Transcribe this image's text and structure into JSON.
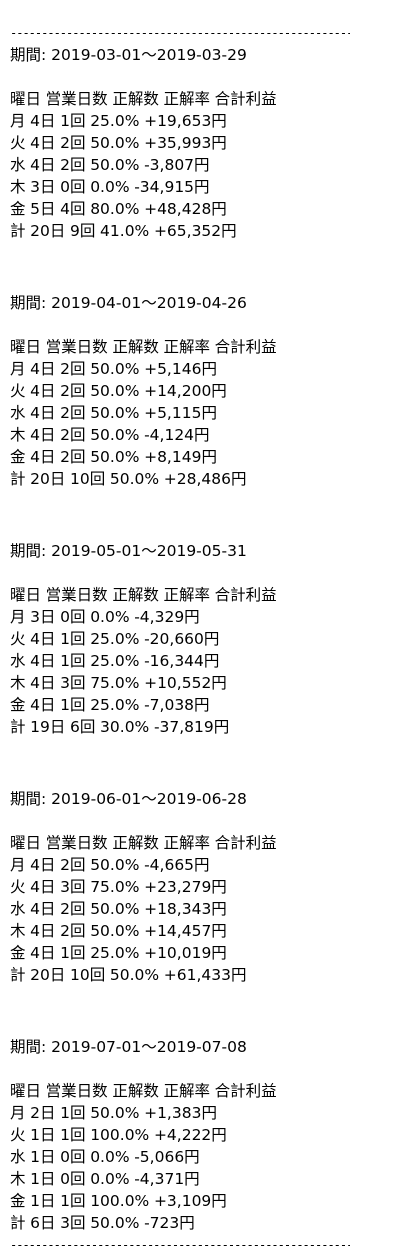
{
  "rule": "------------------------------------------------------------",
  "periods": [
    {
      "label": "期間: 2019-03-01〜2019-03-29",
      "header": [
        "曜日",
        "営業日数",
        "正解数",
        "正解率",
        "合計利益"
      ],
      "rows": [
        [
          "月",
          "4日",
          "1回",
          "25.0%",
          "+19,653円"
        ],
        [
          "火",
          "4日",
          "2回",
          "50.0%",
          "+35,993円"
        ],
        [
          "水",
          "4日",
          "2回",
          "50.0%",
          "-3,807円"
        ],
        [
          "木",
          "3日",
          "0回",
          "0.0%",
          "-34,915円"
        ],
        [
          "金",
          "5日",
          "4回",
          "80.0%",
          "+48,428円"
        ],
        [
          "計",
          "20日",
          "9回",
          "41.0%",
          "+65,352円"
        ]
      ]
    },
    {
      "label": "期間: 2019-04-01〜2019-04-26",
      "header": [
        "曜日",
        "営業日数",
        "正解数",
        "正解率",
        "合計利益"
      ],
      "rows": [
        [
          "月",
          "4日",
          "2回",
          "50.0%",
          "+5,146円"
        ],
        [
          "火",
          "4日",
          "2回",
          "50.0%",
          "+14,200円"
        ],
        [
          "水",
          "4日",
          "2回",
          "50.0%",
          "+5,115円"
        ],
        [
          "木",
          "4日",
          "2回",
          "50.0%",
          "-4,124円"
        ],
        [
          "金",
          "4日",
          "2回",
          "50.0%",
          "+8,149円"
        ],
        [
          "計",
          "20日",
          "10回",
          "50.0%",
          "+28,486円"
        ]
      ]
    },
    {
      "label": "期間: 2019-05-01〜2019-05-31",
      "header": [
        "曜日",
        "営業日数",
        "正解数",
        "正解率",
        "合計利益"
      ],
      "rows": [
        [
          "月",
          "3日",
          "0回",
          "0.0%",
          "-4,329円"
        ],
        [
          "火",
          "4日",
          "1回",
          "25.0%",
          "-20,660円"
        ],
        [
          "水",
          "4日",
          "1回",
          "25.0%",
          "-16,344円"
        ],
        [
          "木",
          "4日",
          "3回",
          "75.0%",
          "+10,552円"
        ],
        [
          "金",
          "4日",
          "1回",
          "25.0%",
          "-7,038円"
        ],
        [
          "計",
          "19日",
          "6回",
          "30.0%",
          "-37,819円"
        ]
      ]
    },
    {
      "label": "期間: 2019-06-01〜2019-06-28",
      "header": [
        "曜日",
        "営業日数",
        "正解数",
        "正解率",
        "合計利益"
      ],
      "rows": [
        [
          "月",
          "4日",
          "2回",
          "50.0%",
          "-4,665円"
        ],
        [
          "火",
          "4日",
          "3回",
          "75.0%",
          "+23,279円"
        ],
        [
          "水",
          "4日",
          "2回",
          "50.0%",
          "+18,343円"
        ],
        [
          "木",
          "4日",
          "2回",
          "50.0%",
          "+14,457円"
        ],
        [
          "金",
          "4日",
          "1回",
          "25.0%",
          "+10,019円"
        ],
        [
          "計",
          "20日",
          "10回",
          "50.0%",
          "+61,433円"
        ]
      ]
    },
    {
      "label": "期間: 2019-07-01〜2019-07-08",
      "header": [
        "曜日",
        "営業日数",
        "正解数",
        "正解率",
        "合計利益"
      ],
      "rows": [
        [
          "月",
          "2日",
          "1回",
          "50.0%",
          "+1,383円"
        ],
        [
          "火",
          "1日",
          "1回",
          "100.0%",
          "+4,222円"
        ],
        [
          "水",
          "1日",
          "0回",
          "0.0%",
          "-5,066円"
        ],
        [
          "木",
          "1日",
          "0回",
          "0.0%",
          "-4,371円"
        ],
        [
          "金",
          "1日",
          "1回",
          "100.0%",
          "+3,109円"
        ],
        [
          "計",
          "6日",
          "3回",
          "50.0%",
          "-723円"
        ]
      ]
    }
  ]
}
